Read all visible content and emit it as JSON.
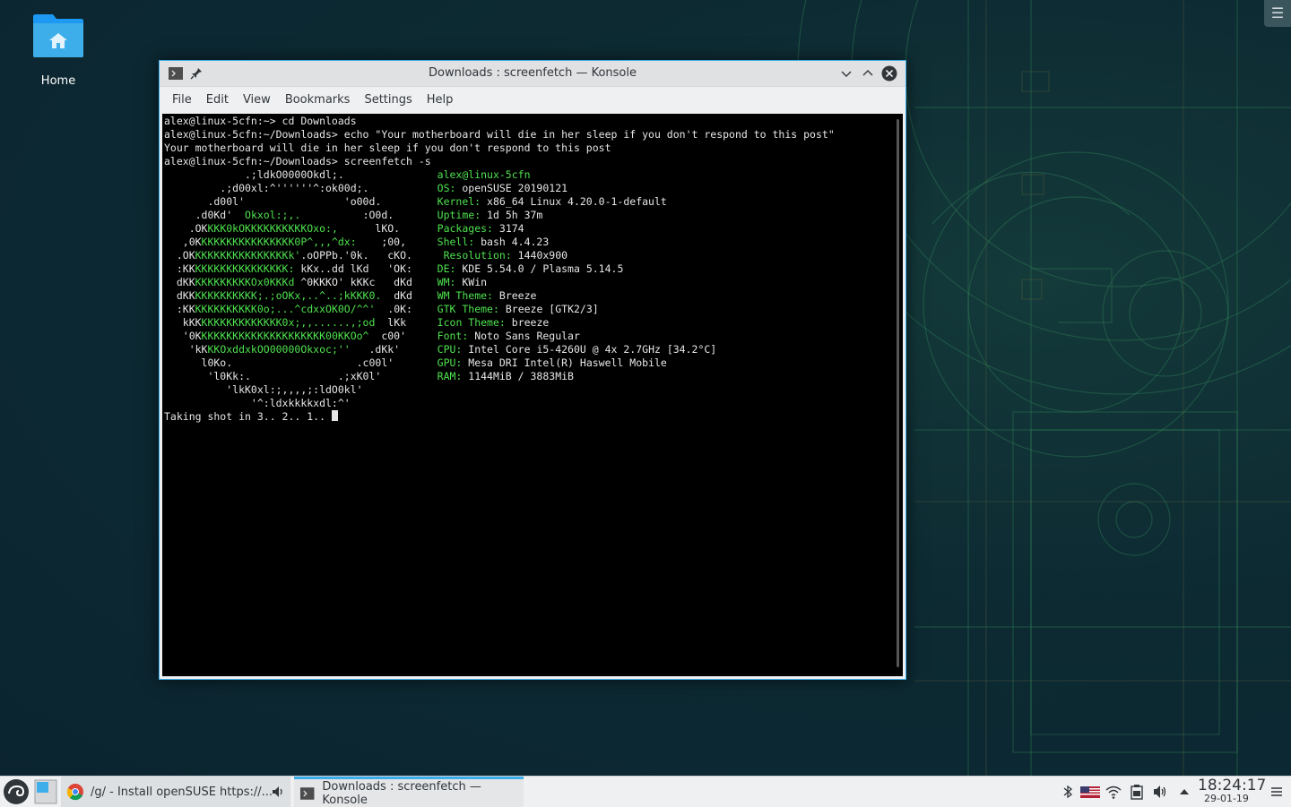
{
  "desktop": {
    "home_label": "Home"
  },
  "window": {
    "title": "Downloads : screenfetch — Konsole",
    "menu": [
      "File",
      "Edit",
      "View",
      "Bookmarks",
      "Settings",
      "Help"
    ]
  },
  "terminal": {
    "lines": [
      [
        [
          "w",
          "alex@linux-5cfn:~> cd Downloads"
        ]
      ],
      [
        [
          "w",
          "alex@linux-5cfn:~/Downloads> echo \"Your motherboard will die in her sleep if you don't respond to this post\""
        ]
      ],
      [
        [
          "w",
          "Your motherboard will die in her sleep if you don't respond to this post"
        ]
      ],
      [
        [
          "w",
          "alex@linux-5cfn:~/Downloads> screenfetch -s"
        ]
      ],
      [
        [
          "w",
          "             .;ldkO0000Okdl;.               "
        ],
        [
          "g",
          "alex@linux-5cfn"
        ]
      ],
      [
        [
          "w",
          "         .;d00xl:^''''''^:ok00d;.           "
        ],
        [
          "g",
          "OS: "
        ],
        [
          "w",
          "openSUSE 20190121"
        ]
      ],
      [
        [
          "w",
          "       .d00l'                'o00d.         "
        ],
        [
          "g",
          "Kernel: "
        ],
        [
          "w",
          "x86_64 Linux 4.20.0-1-default"
        ]
      ],
      [
        [
          "w",
          "     .d0Kd'  "
        ],
        [
          "g",
          "Okxol:;,."
        ],
        [
          "w",
          "          :O0d.       "
        ],
        [
          "g",
          "Uptime: "
        ],
        [
          "w",
          "1d 5h 37m"
        ]
      ],
      [
        [
          "w",
          "    .OK"
        ],
        [
          "g",
          "KKK0kOKKKKKKKKKKOxo:,"
        ],
        [
          "w",
          "      lKO.      "
        ],
        [
          "g",
          "Packages: "
        ],
        [
          "w",
          "3174"
        ]
      ],
      [
        [
          "w",
          "   ,0K"
        ],
        [
          "g",
          "KKKKKKKKKKKKKKK0P^,,,^dx:"
        ],
        [
          "w",
          "    ;00,     "
        ],
        [
          "g",
          "Shell: "
        ],
        [
          "w",
          "bash 4.4.23"
        ]
      ],
      [
        [
          "w",
          "  .OK"
        ],
        [
          "g",
          "KKKKKKKKKKKKKKKk'"
        ],
        [
          "w",
          ".oOPPb.'0k.   cKO.     "
        ],
        [
          "g",
          "Resolution: "
        ],
        [
          "w",
          "1440x900"
        ]
      ],
      [
        [
          "w",
          "  :KK"
        ],
        [
          "g",
          "KKKKKKKKKKKKKKK:"
        ],
        [
          "w",
          " kKx..dd lKd   'OK:    "
        ],
        [
          "g",
          "DE: "
        ],
        [
          "w",
          "KDE 5.54.0 / Plasma 5.14.5"
        ]
      ],
      [
        [
          "w",
          "  dKK"
        ],
        [
          "g",
          "KKKKKKKKKOx0KKKd"
        ],
        [
          "w",
          " ^0KKKO' kKKc   dKd    "
        ],
        [
          "g",
          "WM: "
        ],
        [
          "w",
          "KWin"
        ]
      ],
      [
        [
          "w",
          "  dKK"
        ],
        [
          "g",
          "KKKKKKKKKK;.;oOKx,..^..;kKKK0."
        ],
        [
          "w",
          "  dKd    "
        ],
        [
          "g",
          "WM Theme: "
        ],
        [
          "w",
          "Breeze"
        ]
      ],
      [
        [
          "w",
          "  :KK"
        ],
        [
          "g",
          "KKKKKKKKKK0o;...^cdxxOK0O/^^'"
        ],
        [
          "w",
          "  .0K:    "
        ],
        [
          "g",
          "GTK Theme: "
        ],
        [
          "w",
          "Breeze [GTK2/3]"
        ]
      ],
      [
        [
          "w",
          "   kKK"
        ],
        [
          "g",
          "KKKKKKKKKKKKK0x;,,......,;od"
        ],
        [
          "w",
          "  lKk     "
        ],
        [
          "g",
          "Icon Theme: "
        ],
        [
          "w",
          "breeze"
        ]
      ],
      [
        [
          "w",
          "   '0K"
        ],
        [
          "g",
          "KKKKKKKKKKKKKKKKKKKK00KKOo^"
        ],
        [
          "w",
          "  c00'     "
        ],
        [
          "g",
          "Font: "
        ],
        [
          "w",
          "Noto Sans Regular"
        ]
      ],
      [
        [
          "w",
          "    'kK"
        ],
        [
          "g",
          "KKOxddxkOO00000Okxoc;''"
        ],
        [
          "w",
          "   .dKk'      "
        ],
        [
          "g",
          "CPU: "
        ],
        [
          "w",
          "Intel Core i5-4260U @ 4x 2.7GHz [34.2°C]"
        ]
      ],
      [
        [
          "w",
          "      l0Ko.                    .c00l'       "
        ],
        [
          "g",
          "GPU: "
        ],
        [
          "w",
          "Mesa DRI Intel(R) Haswell Mobile"
        ]
      ],
      [
        [
          "w",
          "       'l0Kk:.              .;xK0l'         "
        ],
        [
          "g",
          "RAM: "
        ],
        [
          "w",
          "1144MiB / 3883MiB"
        ]
      ],
      [
        [
          "w",
          "          'lkK0xl:;,,,,;:ldO0kl'            "
        ]
      ],
      [
        [
          "w",
          "              '^:ldxkkkkxdl:^'              "
        ]
      ],
      [
        [
          "w",
          "Taking shot in 3.. 2.. 1.. "
        ]
      ]
    ]
  },
  "taskbar": {
    "tasks": [
      {
        "label": "/g/ - Install openSUSE https://..."
      },
      {
        "label": "Downloads : screenfetch — Konsole"
      }
    ],
    "clock_time": "18:24:17",
    "clock_date": "29-01-19"
  },
  "colors": {
    "accent": "#3daee9",
    "terminal_green": "#4ee24e",
    "terminal_bg": "#000000"
  }
}
